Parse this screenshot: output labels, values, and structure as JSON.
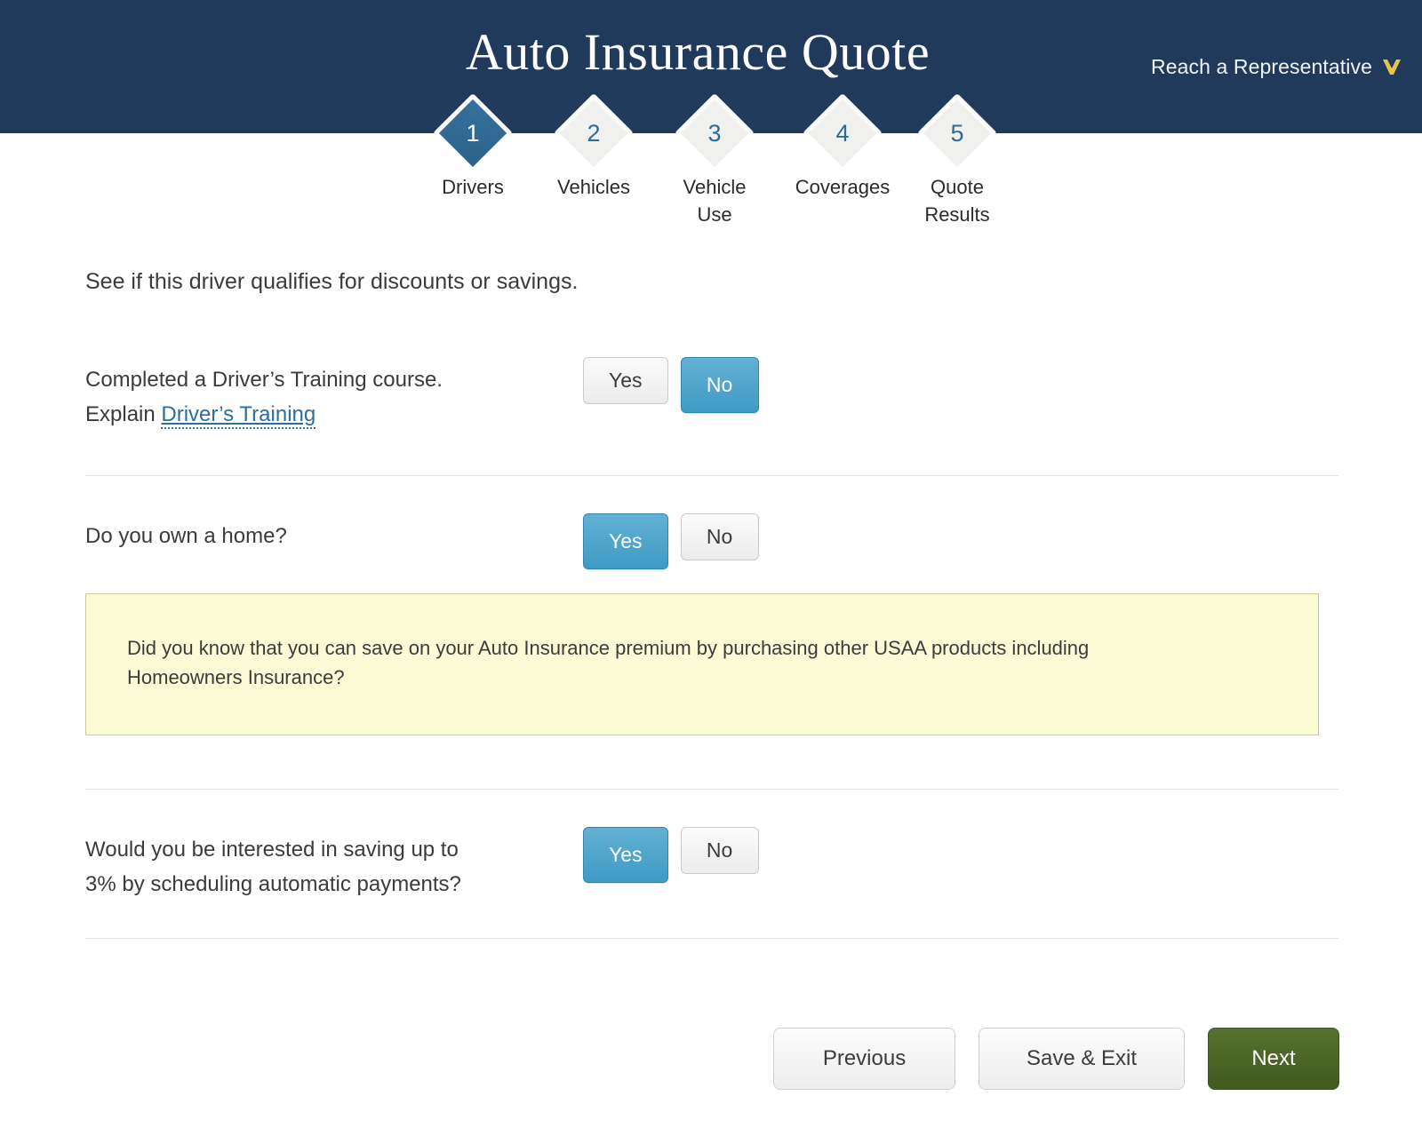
{
  "header": {
    "title": "Auto Insurance Quote",
    "reach_representative": {
      "label": "Reach a Representative",
      "icon": "chevron-down-icon",
      "icon_color": "#e8c24b"
    },
    "background_color": "#1f3a5a"
  },
  "stepper": {
    "active_step": 1,
    "steps": [
      {
        "number": "1",
        "label": "Drivers",
        "active": true
      },
      {
        "number": "2",
        "label": "Vehicles",
        "active": false
      },
      {
        "number": "3",
        "label": "Vehicle\nUse",
        "active": false
      },
      {
        "number": "4",
        "label": "Coverages",
        "active": false
      },
      {
        "number": "5",
        "label": "Quote\nResults",
        "active": false
      }
    ]
  },
  "main": {
    "intro": "See if this driver qualifies for discounts or savings.",
    "questions": [
      {
        "text_line1": "Completed a Driver’s Training course.",
        "explain_prefix": "Explain ",
        "link_label": "Driver’s Training",
        "yes_label": "Yes",
        "no_label": "No",
        "selected": "No"
      },
      {
        "text_line1": "Do you own a home?",
        "yes_label": "Yes",
        "no_label": "No",
        "selected": "Yes"
      },
      {
        "text_line1": "Would you be interested in saving up to",
        "text_line2": "3% by scheduling automatic payments?",
        "yes_label": "Yes",
        "no_label": "No",
        "selected": "Yes"
      }
    ],
    "info_box": {
      "message": "Did you know that you can save on your Auto Insurance premium by purchasing other USAA products including Homeowners Insurance?",
      "background_color": "#fbfbd5",
      "border_color": "#cfc99a"
    }
  },
  "footer": {
    "previous_label": "Previous",
    "save_exit_label": "Save & Exit",
    "next_label": "Next",
    "next_color": "#4d6b2e"
  }
}
